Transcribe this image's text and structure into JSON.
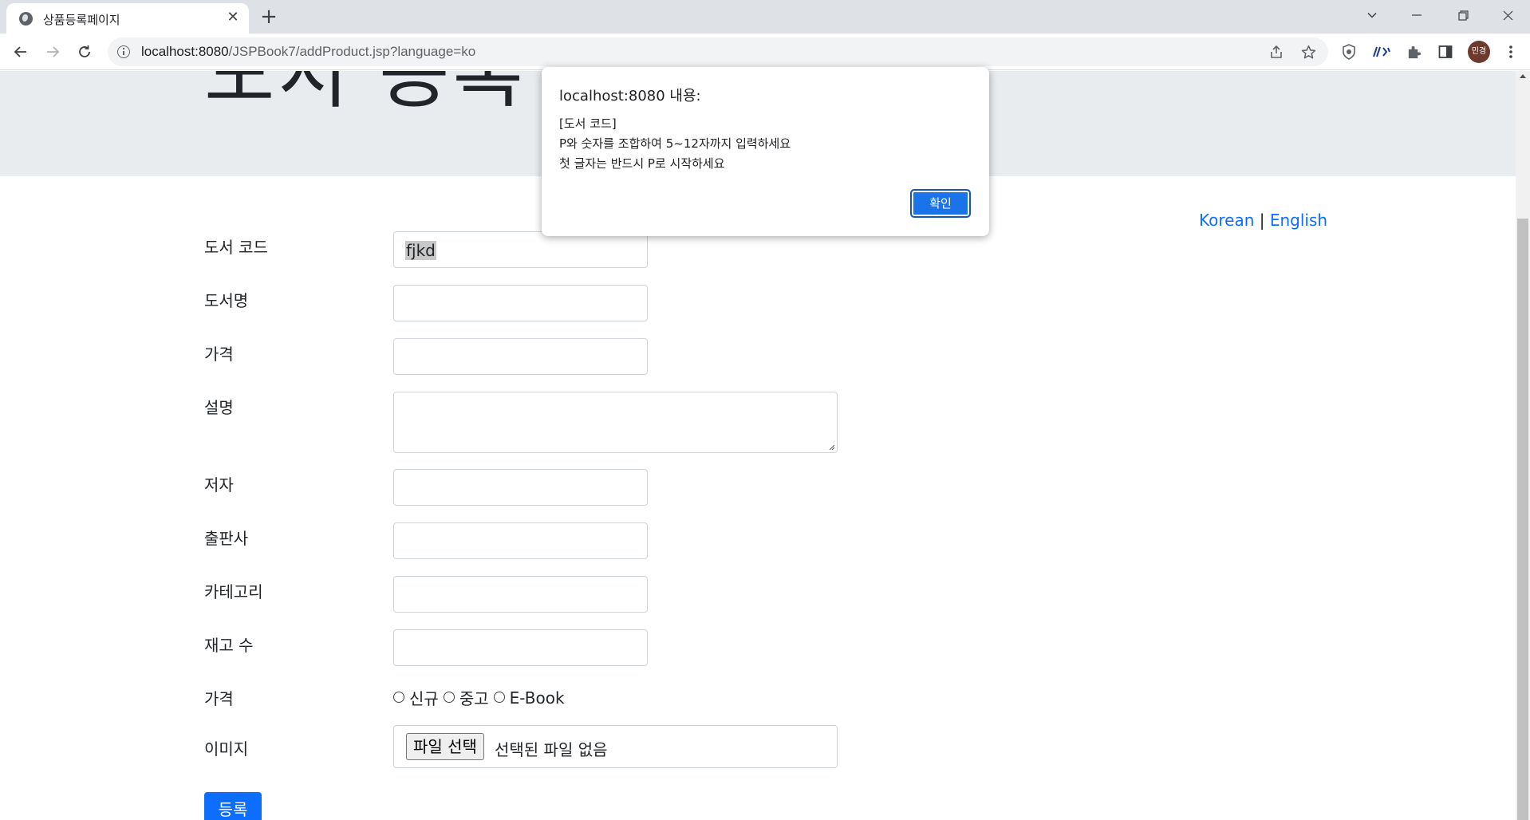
{
  "browser": {
    "tab_title": "상품등록페이지",
    "url_host": "localhost:8080",
    "url_path": "/JSPBook7/addProduct.jsp?language=ko",
    "profile_initials": "민경"
  },
  "page": {
    "jumbotron_title": "도서 등록",
    "lang_korean": "Korean",
    "lang_separator": " | ",
    "lang_english": "English",
    "fields": [
      {
        "label": "도서 코드",
        "value": "fjkd"
      },
      {
        "label": "도서명",
        "value": ""
      },
      {
        "label": "가격",
        "value": ""
      },
      {
        "label": "설명",
        "value": ""
      },
      {
        "label": "저자",
        "value": ""
      },
      {
        "label": "출판사",
        "value": ""
      },
      {
        "label": "카테고리",
        "value": ""
      },
      {
        "label": "재고 수",
        "value": ""
      },
      {
        "label": "가격"
      },
      {
        "label": "이미지"
      }
    ],
    "condition_options": [
      "신규",
      "중고",
      "E-Book"
    ],
    "file_button": "파일 선택",
    "file_status": "선택된 파일 없음",
    "submit_label": "등록"
  },
  "dialog": {
    "title": "localhost:8080 내용:",
    "message": "[도서 코드]\nP와 숫자를 조합하여 5~12자까지 입력하세요\n첫 글자는 반드시 P로 시작하세요",
    "ok_label": "확인"
  }
}
